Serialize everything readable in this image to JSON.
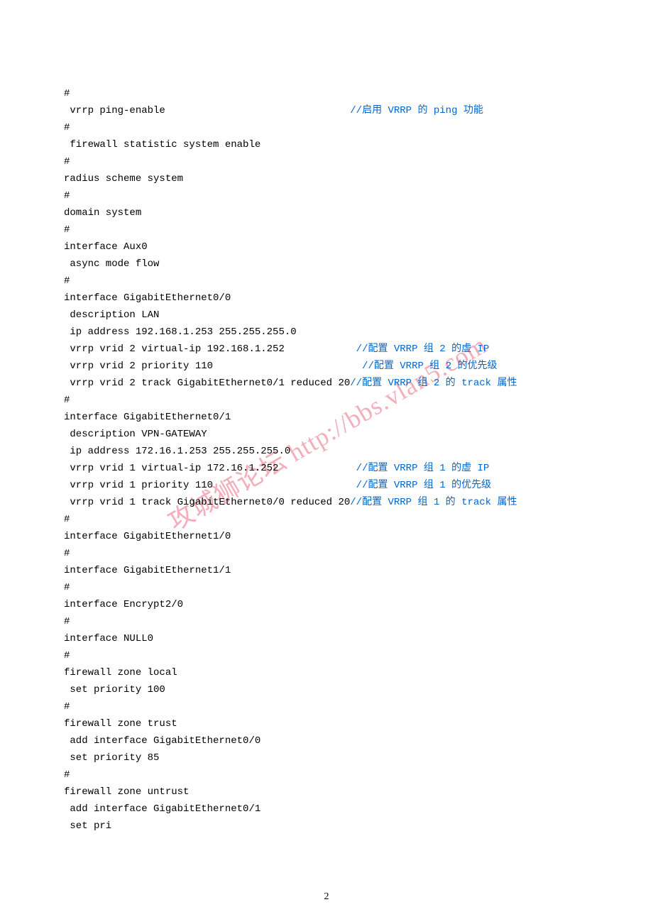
{
  "lines": [
    {
      "text": "#"
    },
    {
      "text": " vrrp ping-enable                               ",
      "comment": "//启用 VRRP 的 ping 功能"
    },
    {
      "text": "#"
    },
    {
      "text": " firewall statistic system enable"
    },
    {
      "text": "#"
    },
    {
      "text": "radius scheme system"
    },
    {
      "text": "#"
    },
    {
      "text": "domain system"
    },
    {
      "text": "#"
    },
    {
      "text": "interface Aux0"
    },
    {
      "text": " async mode flow"
    },
    {
      "text": "#"
    },
    {
      "text": "interface GigabitEthernet0/0"
    },
    {
      "text": " description LAN"
    },
    {
      "text": " ip address 192.168.1.253 255.255.255.0"
    },
    {
      "text": " vrrp vrid 2 virtual-ip 192.168.1.252            ",
      "comment": "//配置 VRRP 组 2 的虚 IP"
    },
    {
      "text": " vrrp vrid 2 priority 110                         ",
      "comment": "//配置 VRRP 组 2 的优先级"
    },
    {
      "text": " vrrp vrid 2 track GigabitEthernet0/1 reduced 20",
      "comment": "//配置 VRRP 组 2 的 track 属性"
    },
    {
      "text": "#"
    },
    {
      "text": "interface GigabitEthernet0/1"
    },
    {
      "text": " description VPN-GATEWAY"
    },
    {
      "text": " ip address 172.16.1.253 255.255.255.0"
    },
    {
      "text": " vrrp vrid 1 virtual-ip 172.16.1.252             ",
      "comment": "//配置 VRRP 组 1 的虚 IP"
    },
    {
      "text": " vrrp vrid 1 priority 110                        ",
      "comment": "//配置 VRRP 组 1 的优先级"
    },
    {
      "text": " vrrp vrid 1 track GigabitEthernet0/0 reduced 20",
      "comment": "//配置 VRRP 组 1 的 track 属性"
    },
    {
      "text": "#"
    },
    {
      "text": "interface GigabitEthernet1/0"
    },
    {
      "text": "#"
    },
    {
      "text": "interface GigabitEthernet1/1"
    },
    {
      "text": "#"
    },
    {
      "text": "interface Encrypt2/0"
    },
    {
      "text": "#"
    },
    {
      "text": "interface NULL0"
    },
    {
      "text": "#"
    },
    {
      "text": "firewall zone local"
    },
    {
      "text": " set priority 100"
    },
    {
      "text": "#"
    },
    {
      "text": "firewall zone trust"
    },
    {
      "text": " add interface GigabitEthernet0/0"
    },
    {
      "text": " set priority 85"
    },
    {
      "text": "#"
    },
    {
      "text": "firewall zone untrust"
    },
    {
      "text": " add interface GigabitEthernet0/1"
    },
    {
      "text": " set pri"
    }
  ],
  "watermark": "攻城狮论坛 http://bbs.vlan5.com",
  "pageNumber": "2"
}
